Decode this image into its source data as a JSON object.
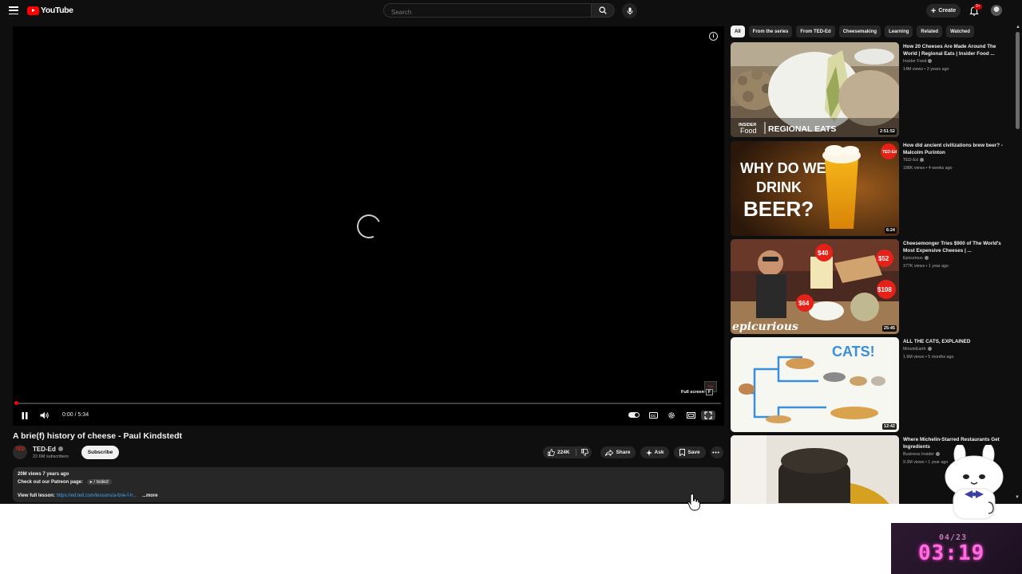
{
  "masthead": {
    "logo_text": "YouTube",
    "search_placeholder": "Search",
    "create_label": "Create",
    "notification_badge": "9+"
  },
  "player": {
    "time": "0:00 / 5:34",
    "progress_fraction": 0.0,
    "fullscreen_tooltip": "Full screen",
    "fullscreen_key": "F",
    "watermark": "TED"
  },
  "video": {
    "title": "A brie(f) history of cheese - Paul Kindstedt",
    "channel": "TED-Ed",
    "channel_avatar_text": "TED",
    "subscribers": "22.6M subscribers",
    "subscribe_label": "Subscribe",
    "likes": "224K",
    "share_label": "Share",
    "ask_label": "Ask",
    "save_label": "Save"
  },
  "description": {
    "meta": "20M views  7 years ago",
    "patreon_label": "Check out our Patreon page:",
    "patreon_tag": "/ teded",
    "lesson_label": "View full lesson:",
    "lesson_link": "https://ed.ted.com/lessons/a-brie-f-h...",
    "more_label": "...more"
  },
  "chips": [
    "All",
    "From the series",
    "From TED-Ed",
    "Cheesemaking",
    "Learning",
    "Related",
    "Watched"
  ],
  "recommendations": [
    {
      "title": "How 20 Cheeses Are Made Around The World | Regional Eats | Insider Food ...",
      "channel": "Insider Food",
      "meta": "14M views • 2 years ago",
      "duration": "2:51:52",
      "thumb_text_small": "INSIDER",
      "thumb_text_food": "Food",
      "thumb_text_big": "REGIONAL EATS"
    },
    {
      "title": "How did ancient civilizations brew beer? - Malcolm Purinton",
      "channel": "TED-Ed",
      "meta": "188K views • 4 weeks ago",
      "duration": "6:24",
      "thumb_line1": "WHY DO WE",
      "thumb_line2": "DRINK",
      "thumb_line3": "BEER?",
      "thumb_logo": "TED-Ed"
    },
    {
      "title": "Cheesemonger Tries $900 of The World's Most Expensive Cheeses | ...",
      "channel": "Epicurious",
      "meta": "377K views • 1 year ago",
      "duration": "25:45",
      "thumb_prices": [
        "$40",
        "$52",
        "$108",
        "$64"
      ],
      "thumb_brand": "epicurious"
    },
    {
      "title": "ALL THE CATS, EXPLAINED",
      "channel": "MinuteEarth",
      "meta": "1.9M views • 5 months ago",
      "duration": "12:42",
      "thumb_text": "CATS!"
    },
    {
      "title": "Where Michelin-Starred Restaurants Get Ingredients",
      "channel": "Business Insider",
      "meta": "9.3M views • 1 year ago",
      "duration": ""
    }
  ],
  "overlay_clock": {
    "date": "04/23",
    "time": "03:19"
  },
  "colors": {
    "accent": "#ff0000",
    "background": "#0f0f0f",
    "link": "#3ea6ff",
    "clock": "#ff6ce0"
  }
}
